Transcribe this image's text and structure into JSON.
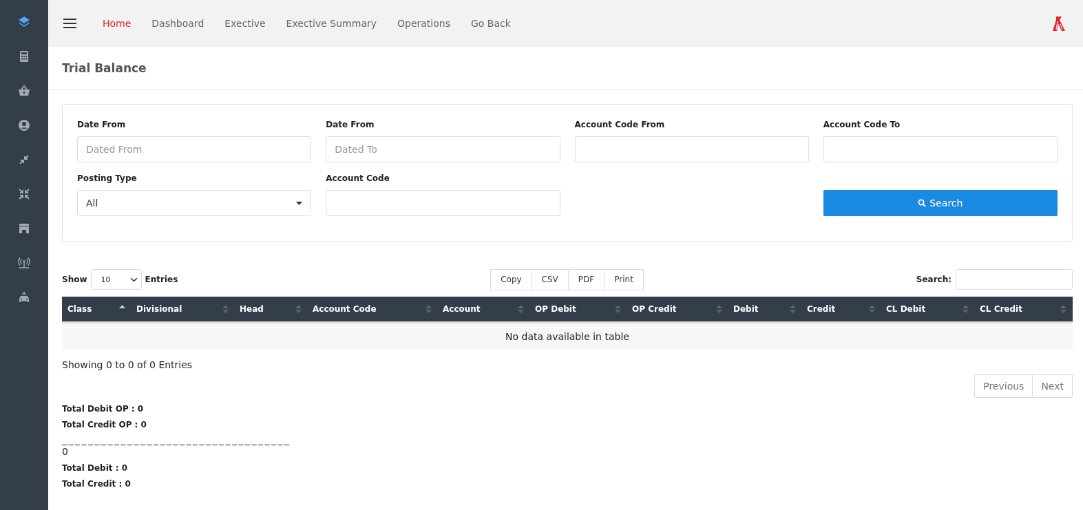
{
  "sidebar": {
    "items": [
      {
        "kind": "layers",
        "selected": true
      },
      {
        "kind": "calculator",
        "selected": false
      },
      {
        "kind": "basket",
        "selected": false
      },
      {
        "kind": "user",
        "selected": false
      },
      {
        "kind": "compress",
        "selected": false
      },
      {
        "kind": "compressall",
        "selected": false
      },
      {
        "kind": "store",
        "selected": false
      },
      {
        "kind": "broadcast",
        "selected": false
      },
      {
        "kind": "car",
        "selected": false
      }
    ]
  },
  "nav": {
    "items": [
      {
        "label": "Home",
        "selected": true
      },
      {
        "label": "Dashboard",
        "selected": false
      },
      {
        "label": "Exective",
        "selected": false
      },
      {
        "label": "Exective Summary",
        "selected": false
      },
      {
        "label": "Operations",
        "selected": false
      },
      {
        "label": "Go Back",
        "selected": false
      }
    ]
  },
  "page_title": "Trial Balance",
  "filters": [
    {
      "kind": "input",
      "label": "Date From",
      "placeholder": "Dated From"
    },
    {
      "kind": "input",
      "label": "Date From",
      "placeholder": "Dated To"
    },
    {
      "kind": "input",
      "label": "Account Code From"
    },
    {
      "kind": "input",
      "label": "Account Code To"
    },
    {
      "kind": "select",
      "label": "Posting Type",
      "value": "All"
    },
    {
      "kind": "input",
      "label": "Account Code"
    },
    {
      "kind": "empty"
    },
    {
      "kind": "button",
      "label": "Search"
    }
  ],
  "length": {
    "before": "Show",
    "value": "10",
    "after": "Entries"
  },
  "export_buttons": [
    "Copy",
    "CSV",
    "PDF",
    "Print"
  ],
  "table_search": {
    "label": "Search:"
  },
  "table": {
    "columns": [
      {
        "label": "Class",
        "kind": "ascending"
      },
      {
        "label": "Divisional",
        "kind": "sortable"
      },
      {
        "label": "Head",
        "kind": "sortable"
      },
      {
        "label": "Account Code",
        "kind": "sortable"
      },
      {
        "label": "Account",
        "kind": "sortable"
      },
      {
        "label": "OP Debit",
        "kind": "sortable"
      },
      {
        "label": "OP Credit",
        "kind": "sortable"
      },
      {
        "label": "Debit",
        "kind": "sortable"
      },
      {
        "label": "Credit",
        "kind": "sortable"
      },
      {
        "label": "CL Debit",
        "kind": "sortable"
      },
      {
        "label": "CL Credit",
        "kind": "sortable"
      }
    ],
    "empty_message": "No data available in table"
  },
  "info": "Showing 0 to 0 of 0 Entries",
  "pagination": [
    "Previous",
    "Next"
  ],
  "totals_op": [
    "Total Debit OP : 0",
    "Total Credit OP : 0"
  ],
  "separator": "___________________________________",
  "difference": "0",
  "totals": [
    "Total Debit : 0",
    "Total Credit : 0"
  ]
}
